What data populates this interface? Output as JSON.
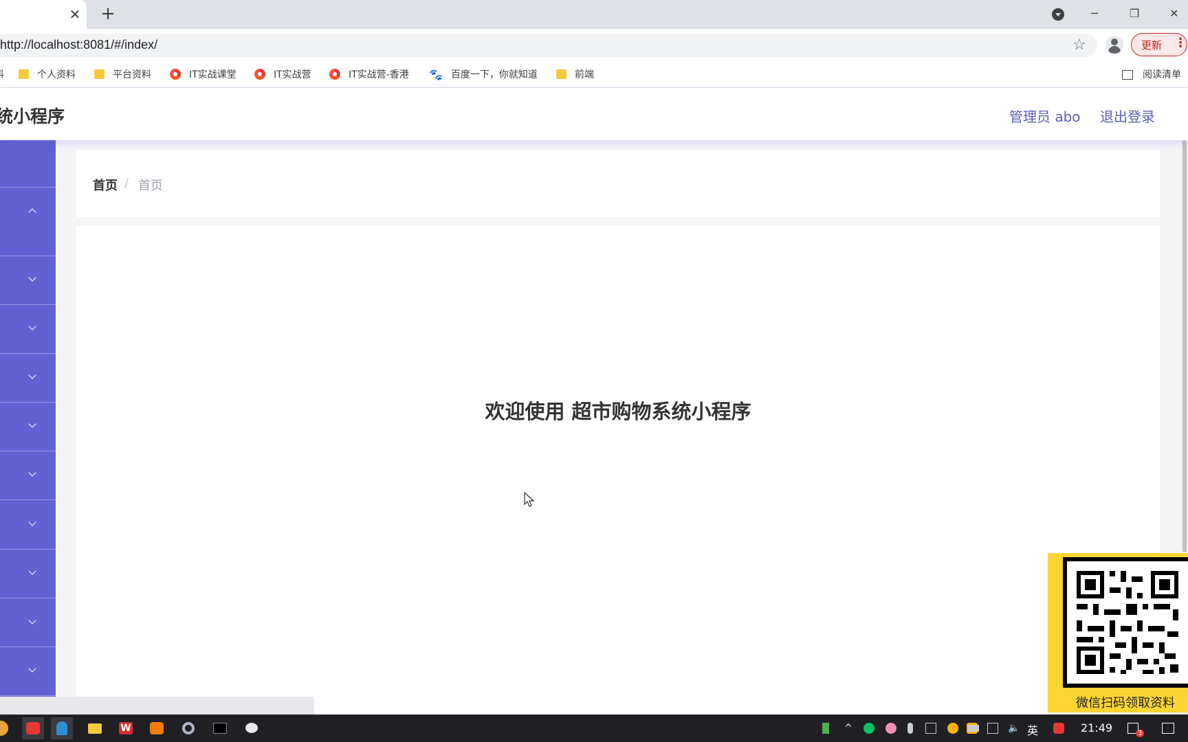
{
  "browser": {
    "tab_close": "✕",
    "new_tab": "+",
    "url": "http://localhost:8081/#/index/",
    "update_label": "更新",
    "bookmarks": [
      {
        "icon": "folder",
        "label": "个人资料"
      },
      {
        "icon": "folder",
        "label": "平台资料"
      },
      {
        "icon": "chrome",
        "label": "IT实战课堂"
      },
      {
        "icon": "chrome",
        "label": "IT实战营"
      },
      {
        "icon": "chrome",
        "label": "IT实战营-香港"
      },
      {
        "icon": "baidu",
        "label": "百度一下，你就知道"
      },
      {
        "icon": "folder",
        "label": "前端"
      }
    ],
    "bookmark_cut_left": "料",
    "reading_list": "阅读清单"
  },
  "header": {
    "title": "统小程序",
    "user": "管理员 abo",
    "logout": "退出登录"
  },
  "sidebar": {
    "items_count": 11
  },
  "breadcrumb": {
    "home": "首页",
    "separator": "/",
    "current": "首页"
  },
  "main": {
    "welcome": "欢迎使用 超市购物系统小程序"
  },
  "overlay": {
    "qr_caption": "微信扫码领取资料"
  },
  "taskbar": {
    "lang": "英",
    "time": "21:49",
    "notification_count": "3"
  },
  "colors": {
    "sidebar": "#6062d2",
    "accent_text": "#5b5fb0",
    "qr_bg": "#fcd535"
  }
}
